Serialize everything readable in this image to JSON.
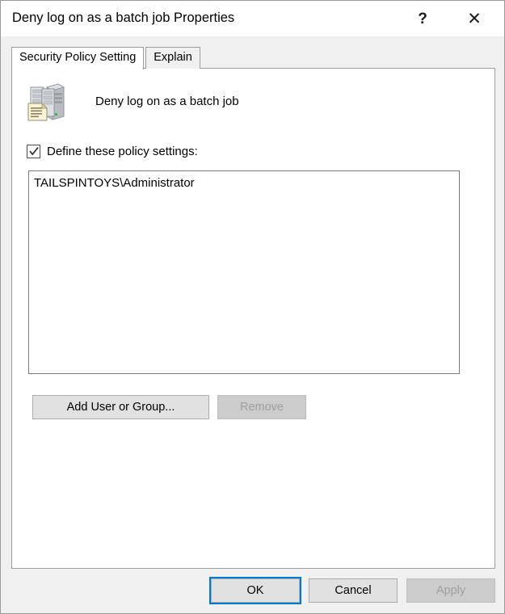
{
  "window": {
    "title": "Deny log on as a batch job Properties",
    "help_button": "?",
    "close_button": "✕",
    "help_icon_name": "help-icon",
    "close_icon_name": "close-icon"
  },
  "tabs": [
    {
      "label": "Security Policy Setting",
      "active": true
    },
    {
      "label": "Explain",
      "active": false
    }
  ],
  "policy": {
    "icon_name": "policy-server-document-icon",
    "name": "Deny log on as a batch job"
  },
  "define_checkbox": {
    "label": "Define these policy settings:",
    "checked": true
  },
  "principal_list": {
    "items": [
      "TAILSPINTOYS\\Administrator"
    ]
  },
  "list_buttons": {
    "add": {
      "label": "Add User or Group...",
      "enabled": true
    },
    "remove": {
      "label": "Remove",
      "enabled": false
    }
  },
  "footer": {
    "ok": {
      "label": "OK",
      "enabled": true,
      "is_default": true
    },
    "cancel": {
      "label": "Cancel",
      "enabled": true
    },
    "apply": {
      "label": "Apply",
      "enabled": false
    }
  },
  "colors": {
    "dialog_background": "#f0f0f0",
    "panel_background": "#ffffff",
    "accent_focus": "#0078d7",
    "button_face": "#e1e1e1",
    "disabled_text": "#a0a0a0",
    "border": "#9e9e9e"
  }
}
